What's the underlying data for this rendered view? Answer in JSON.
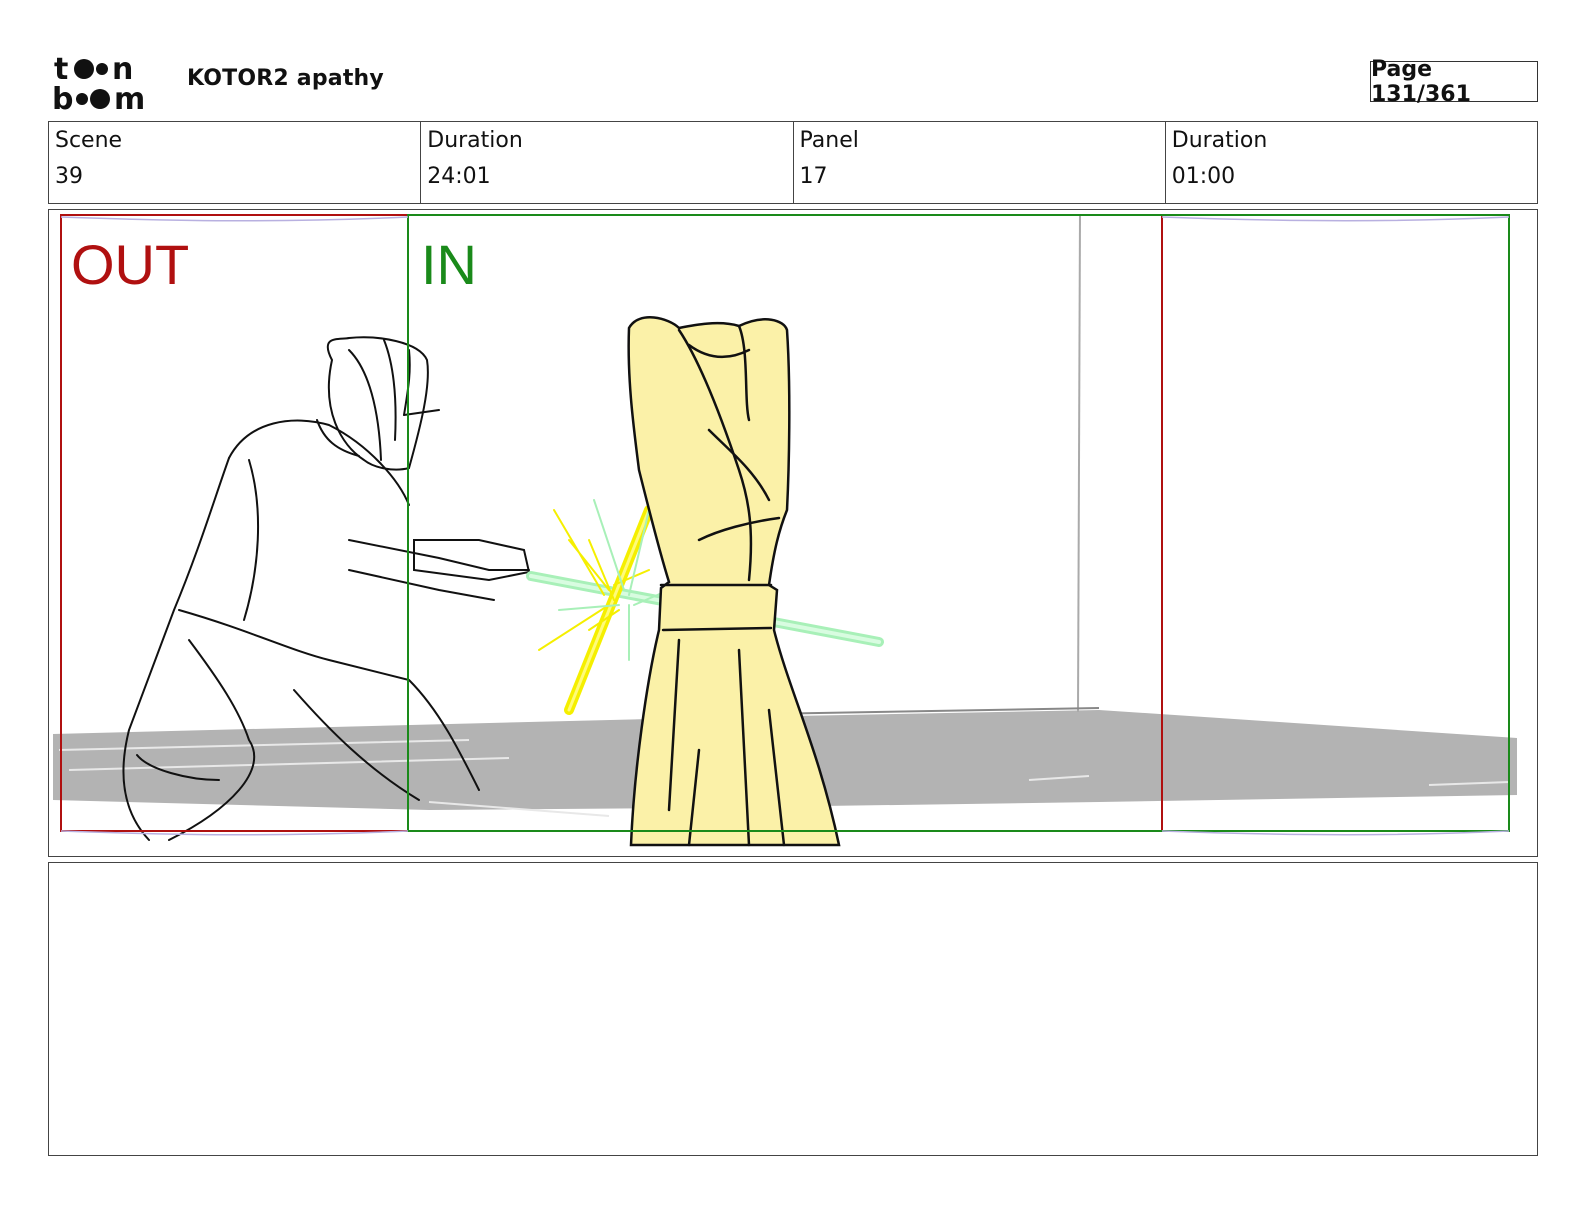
{
  "header": {
    "logo_text": "toon boom",
    "project_title": "KOTOR2 apathy",
    "page_label": "Page 131/361"
  },
  "info": {
    "scene_label": "Scene",
    "scene_value": "39",
    "scene_duration_label": "Duration",
    "scene_duration_value": "24:01",
    "panel_label": "Panel",
    "panel_value": "17",
    "panel_duration_label": "Duration",
    "panel_duration_value": "01:00"
  },
  "frame": {
    "out_label": "OUT",
    "in_label": "IN",
    "colors": {
      "out": "#b01010",
      "in": "#1a8a1a",
      "yellow_saber": "#f5ef00",
      "green_saber": "#a8f0b8",
      "robe": "#fbf1a8",
      "floor": "#b0b0b0"
    }
  },
  "notes": {
    "text": ""
  }
}
